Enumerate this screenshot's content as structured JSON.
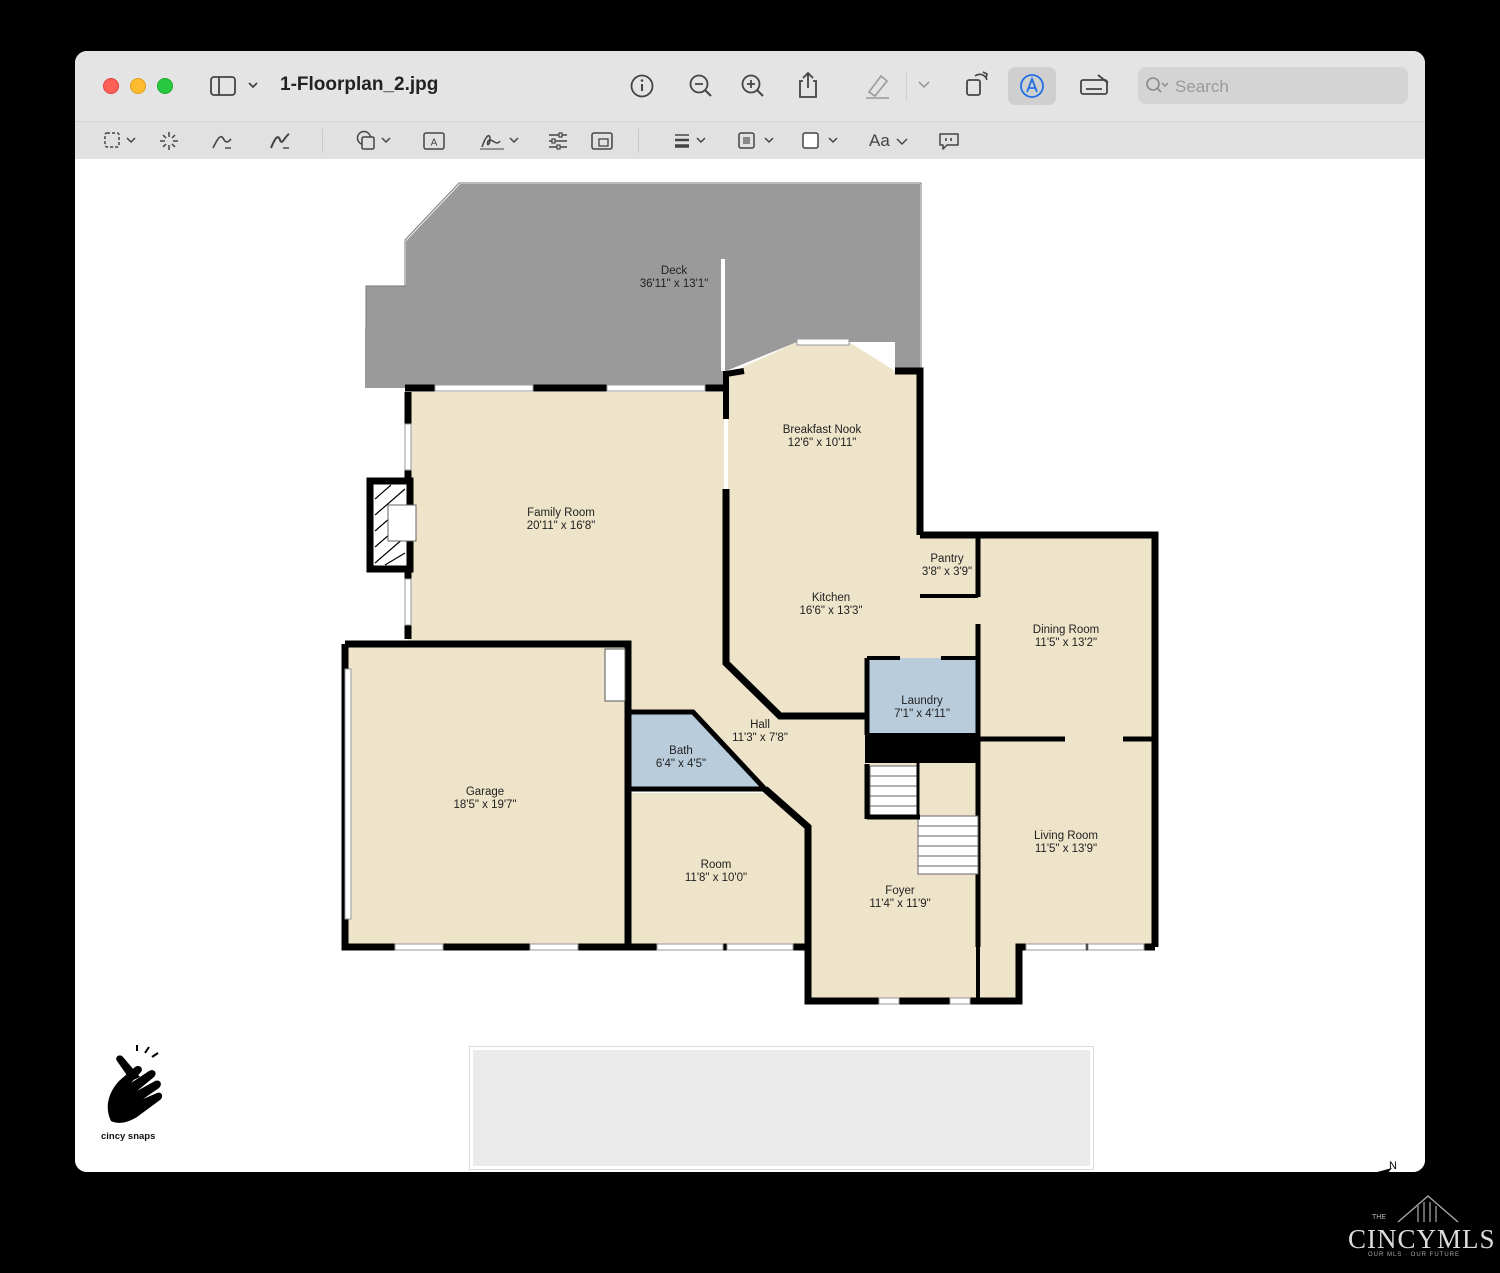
{
  "window": {
    "title": "1-Floorplan_2.jpg",
    "search_placeholder": "Search"
  },
  "toolbar": {
    "buttons": [
      "sidebar",
      "info",
      "zoom-out",
      "zoom-in",
      "share",
      "highlight",
      "rotate",
      "markup",
      "sign"
    ],
    "markup_tools": [
      "selection",
      "instant-alpha",
      "sketch",
      "draw",
      "shapes",
      "text",
      "sign",
      "adjust-color",
      "adjust-size",
      "shape-style",
      "border-color",
      "fill-color",
      "text-style",
      "notes"
    ],
    "text_style_label": "Aa"
  },
  "floorplan": {
    "rooms": [
      {
        "name": "Deck",
        "dims": "36'11\" x 13'1\""
      },
      {
        "name": "Breakfast Nook",
        "dims": "12'6\" x 10'11\""
      },
      {
        "name": "Family Room",
        "dims": "20'11\" x 16'8\""
      },
      {
        "name": "Pantry",
        "dims": "3'8\" x 3'9\""
      },
      {
        "name": "Kitchen",
        "dims": "16'6\" x 13'3\""
      },
      {
        "name": "Dining Room",
        "dims": "11'5\" x 13'2\""
      },
      {
        "name": "Laundry",
        "dims": "7'1\" x 4'11\""
      },
      {
        "name": "Hall",
        "dims": "11'3\" x 7'8\""
      },
      {
        "name": "Bath",
        "dims": "6'4\" x 4'5\""
      },
      {
        "name": "Garage",
        "dims": "18'5\" x 19'7\""
      },
      {
        "name": "Living Room",
        "dims": "11'5\" x 13'9\""
      },
      {
        "name": "Room",
        "dims": "11'8\" x 10'0\""
      },
      {
        "name": "Foyer",
        "dims": "11'4\" x 11'9\""
      }
    ],
    "compass_label": "N",
    "colors": {
      "deck": "#9a9a9a",
      "room": "#ede4c9",
      "wet_room": "#b8ccdc",
      "wall": "#000000"
    }
  },
  "branding": {
    "logo_text": "cincy snaps",
    "mls_the": "THE",
    "mls_name": "CINCYMLS",
    "mls_tagline": "OUR MLS · OUR FUTURE"
  }
}
